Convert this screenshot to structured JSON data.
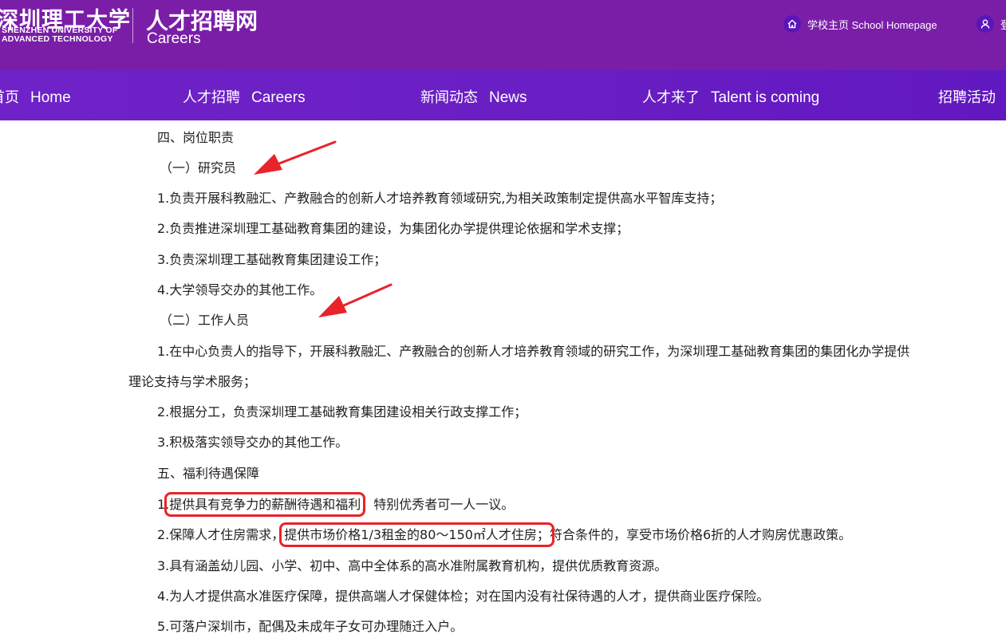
{
  "header": {
    "logo_cn": "深圳理工大学",
    "logo_en_line1": "SHENZHEN UNIVERSITY OF",
    "logo_en_line2": "ADVANCED TECHNOLOGY",
    "site_title": "人才招聘网",
    "site_subtitle": "Careers",
    "home_link_label": "学校主页 School Homepage",
    "home_icon": "home-icon",
    "user_icon": "user-icon",
    "user_link_label": "登",
    "background_color": "#7a1ea8"
  },
  "nav": {
    "background_color": "#6a1fc4",
    "items": [
      {
        "cn": "首页",
        "en": "Home"
      },
      {
        "cn": "人才招聘",
        "en": "Careers"
      },
      {
        "cn": "新闻动态",
        "en": "News"
      },
      {
        "cn": "人才来了",
        "en": "Talent is coming"
      },
      {
        "cn": "招聘活动",
        "en": ""
      }
    ]
  },
  "article": {
    "section4_heading": "四、岗位职责",
    "sub1_heading": "（一）研究员",
    "sub1_items": [
      "1.负责开展科教融汇、产教融合的创新人才培养教育领域研究,为相关政策制定提供高水平智库支持；",
      "2.负责推进深圳理工基础教育集团的建设，为集团化办学提供理论依据和学术支撑；",
      "3.负责深圳理工基础教育集团建设工作；",
      "4.大学领导交办的其他工作。"
    ],
    "sub2_heading": "（二）工作人员",
    "sub2_item1_part1": "1.在中心负责人的指导下，开展科教融汇、产教融合的创新人才培养教育领域的研究工作，为深圳理工基础教育集团的集团化办学提供",
    "sub2_item1_part2": "理论支持与学术服务；",
    "sub2_items": [
      "2.根据分工，负责深圳理工基础教育集团建设相关行政支撑工作；",
      "3.积极落实领导交办的其他工作。"
    ],
    "section5_heading": "五、福利待遇保障",
    "benefit1": {
      "prefix": "1.",
      "highlight": "提供具有竞争力的薪酬待遇和福利",
      "suffix": "，特别优秀者可一人一议。"
    },
    "benefit2": {
      "prefix": "2.保障人才住房需求，",
      "highlight": "提供市场价格1/3租金的80～150㎡人才住房；",
      "suffix": "符合条件的，享受市场价格6折的人才购房优惠政策。"
    },
    "benefits_rest": [
      "3.具有涵盖幼儿园、小学、初中、高中全体系的高水准附属教育机构，提供优质教育资源。",
      "4.为人才提供高水准医疗保障，提供高端人才保健体检；对在国内没有社保待遇的人才，提供商业医疗保险。",
      "5.可落户深圳市，配偶及未成年子女可办理随迁入户。"
    ]
  },
  "annotations": {
    "arrow_color": "#e8232a",
    "highlight_box_color": "#e8232a"
  }
}
